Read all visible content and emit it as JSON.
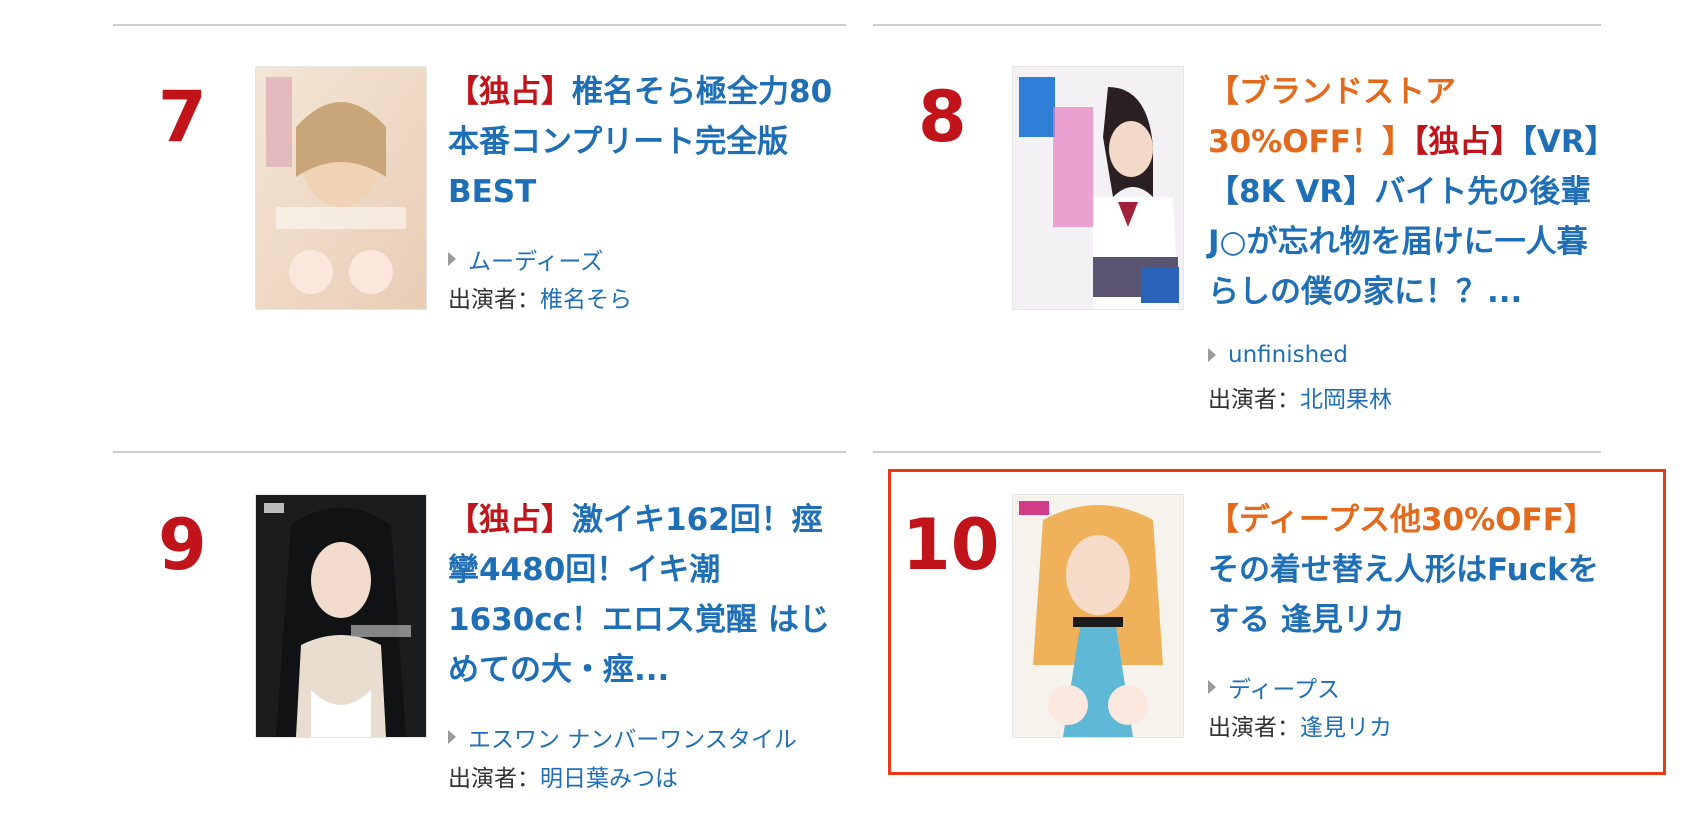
{
  "accent_red": "#c0141a",
  "accent_orange": "#e36a1c",
  "link_blue": "#1e6fb5",
  "highlight_border": "#ea3a16",
  "cast_prefix": "出演者：",
  "items": [
    {
      "rank": "7",
      "title_tags": [
        {
          "text": "【独占】",
          "color": "red"
        }
      ],
      "title_rest": "椎名そら極全力80本番コンプリート完全版BEST",
      "maker": "ムーディーズ",
      "cast": "椎名そら",
      "thumb_icon": "product-cover-image"
    },
    {
      "rank": "8",
      "title_tags": [
        {
          "text": "【ブランドストア30%OFF！】",
          "color": "orange"
        },
        {
          "text": "【独占】",
          "color": "red"
        }
      ],
      "title_rest": "【VR】【8K VR】バイト先の後輩J○が忘れ物を届けに一人暮らしの僕の家に！？...",
      "maker": "unfinished",
      "cast": "北岡果林",
      "thumb_icon": "product-cover-image"
    },
    {
      "rank": "9",
      "title_tags": [
        {
          "text": "【独占】",
          "color": "red"
        }
      ],
      "title_rest": "激イキ162回！痙攣4480回！イキ潮1630cc！エロス覚醒 はじめての大・痙...",
      "maker": "エスワン ナンバーワンスタイル",
      "cast": "明日葉みつは",
      "thumb_icon": "product-cover-image"
    },
    {
      "rank": "10",
      "title_tags": [
        {
          "text": "【ディープス他30%OFF】",
          "color": "orange"
        }
      ],
      "title_rest": "その着せ替え人形はFuckをする 逢見リカ",
      "maker": "ディープス",
      "cast": "逢見リカ",
      "thumb_icon": "product-cover-image",
      "highlighted": true
    }
  ]
}
